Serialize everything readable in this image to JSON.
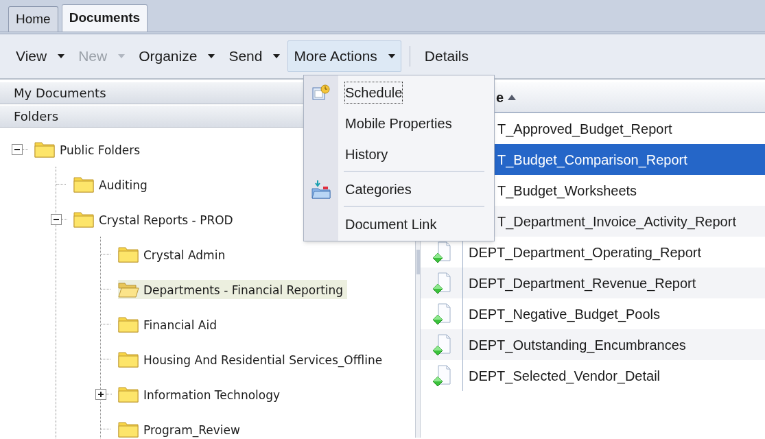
{
  "tabs": [
    {
      "label": "Home",
      "selected": false
    },
    {
      "label": "Documents",
      "selected": true
    }
  ],
  "toolbar": [
    {
      "label": "View",
      "disabled": false,
      "expanded": false,
      "dropdown": true
    },
    {
      "label": "New",
      "disabled": true,
      "expanded": false,
      "dropdown": true
    },
    {
      "label": "Organize",
      "disabled": false,
      "expanded": false,
      "dropdown": true
    },
    {
      "label": "Send",
      "disabled": false,
      "expanded": false,
      "dropdown": true
    },
    {
      "label": "More Actions",
      "disabled": false,
      "expanded": true,
      "dropdown": true
    },
    {
      "label": "Details",
      "disabled": false,
      "expanded": false,
      "dropdown": false
    }
  ],
  "menu": [
    {
      "kind": "schedule",
      "label": "Schedule",
      "focused": true
    },
    {
      "kind": "plain",
      "label": "Mobile Properties",
      "focused": false
    },
    {
      "kind": "plain",
      "label": "History",
      "focused": false
    },
    {
      "kind": "separator"
    },
    {
      "kind": "categories",
      "label": "Categories",
      "focused": false
    },
    {
      "kind": "separator"
    },
    {
      "kind": "plain",
      "label": "Document Link",
      "focused": false
    }
  ],
  "left_panel": {
    "sections": [
      "My Documents",
      "Folders"
    ],
    "tree": [
      {
        "label": "Public Folders",
        "expanded": true,
        "selected": false,
        "children": [
          {
            "label": "Auditing",
            "selected": false
          },
          {
            "label": "Crystal Reports - PROD",
            "expanded": true,
            "selected": false,
            "children": [
              {
                "label": "Crystal Admin",
                "selected": false
              },
              {
                "label": "Departments - Financial Reporting",
                "selected": true
              },
              {
                "label": "Financial Aid",
                "selected": false
              },
              {
                "label": "Housing And Residential Services_Offline",
                "selected": false
              },
              {
                "label": "Information Technology",
                "expanded": false,
                "selected": false
              },
              {
                "label": "Program_Review",
                "selected": false
              }
            ]
          }
        ]
      }
    ]
  },
  "table": {
    "header": "e",
    "sort_ascending": true,
    "rows": [
      {
        "kind": "covered",
        "title": "T_Approved_Budget_Report",
        "selected": false
      },
      {
        "kind": "covered",
        "title": "T_Budget_Comparison_Report",
        "selected": true
      },
      {
        "kind": "covered",
        "title": "T_Budget_Worksheets",
        "selected": false
      },
      {
        "kind": "covered",
        "title": "T_Department_Invoice_Activity_Report",
        "selected": false
      },
      {
        "kind": "report",
        "title": "DEPT_Department_Operating_Report",
        "selected": false
      },
      {
        "kind": "report",
        "title": "DEPT_Department_Revenue_Report",
        "selected": false
      },
      {
        "kind": "report",
        "title": "DEPT_Negative_Budget_Pools",
        "selected": false
      },
      {
        "kind": "report",
        "title": "DEPT_Outstanding_Encumbrances",
        "selected": false
      },
      {
        "kind": "report",
        "title": "DEPT_Selected_Vendor_Detail",
        "selected": false
      }
    ]
  }
}
